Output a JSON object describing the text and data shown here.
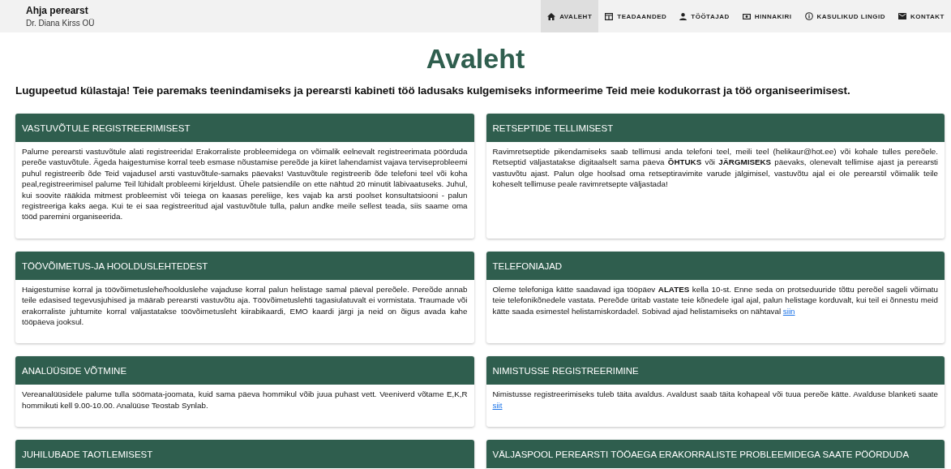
{
  "header": {
    "title": "Ahja perearst",
    "subtitle": "Dr. Diana Kirss OÜ"
  },
  "nav": [
    {
      "label": "AVALEHT",
      "kind": "home",
      "selected": true
    },
    {
      "label": "TEADAANDED",
      "kind": "board",
      "selected": false
    },
    {
      "label": "TÖÖTAJAD",
      "kind": "person",
      "selected": false
    },
    {
      "label": "HINNAKIRI",
      "kind": "cash",
      "selected": false
    },
    {
      "label": "KASULIKUD LINGID",
      "kind": "info",
      "selected": false
    },
    {
      "label": "KONTAKT",
      "kind": "mail",
      "selected": false
    }
  ],
  "page_title": "Avaleht",
  "intro": "Lugupeetud külastaja! Teie paremaks teenindamiseks ja perearsti kabineti töö ladusaks kulgemiseks informeerime Teid meie kodukorrast ja töö organiseerimisest.",
  "cards": [
    {
      "title": "VASTUVÕTULE REGISTREERIMISEST",
      "body": [
        {
          "kind": "text",
          "text": "Palume perearsti vastuvõtule alati registreerida! Erakorraliste probleemidega on võimalik eelnevalt registreerimata pöörduda pereõe vastuvõtule. Ägeda haigestumise korral teeb esmase nõustamise pereõde ja kiiret lahendamist vajava terviseprobleemi puhul registreerib õde Teid vajadusel arsti vastuvõtule-samaks päevaks! Vastuvõtule registreerib õde telefoni teel või koha peal,registreerimisel palume Teil lühidalt probleemi kirjeldust. Ühele patsiendile on ette nähtud 20 minutit läbivaatuseks. Juhul, kui soovite rääkida mitmest probleemist või teiega on kaasas pereliige, kes vajab ka arsti poolset konsultatsiooni - palun registreeriga kaks aega. Kui te ei saa registreeritud ajal vastuvõtule tulla, palun andke meile sellest teada, siis saame oma tööd paremini organiseerida."
        }
      ]
    },
    {
      "title": "RETSEPTIDE TELLIMISEST",
      "body": [
        {
          "kind": "text",
          "text": "Ravimretseptide pikendamiseks saab tellimusi anda telefoni teel, meili teel (helikaur@hot.ee) või kohale tulles pereõele. Retseptid väljastatakse digitaalselt sama päeva **ÕHTUKS** või **JÄRGMISEKS** päevaks, olenevalt tellimise ajast ja perearsti vastuvõtu ajast. Palun olge hoolsad oma retseptiravimite varude jälgimisel, vastuvõtu ajal ei ole perearstil võimalik teile koheselt tellimuse peale ravimretsepte väljastada!"
        }
      ]
    },
    {
      "title": "TÖÖVÕIMETUS-JA HOOLDUSLEHTEDEST",
      "body": [
        {
          "kind": "text",
          "text": "Haigestumise korral ja töövõimetuslehe/hoolduslehe vajaduse korral palun helistage samal päeval pereõele. Pereõde annab teile edasised tegevusjuhised ja määrab perearsti vastuvõtu aja. Töövõimetuslehti tagasiulatuvalt ei vormistata. Traumade või erakorraliste juhtumite korral väljastatakse töövõimetusleht kiirabikaardi, EMO kaardi järgi ja neid on õigus avada kahe tööpäeva jooksul."
        }
      ]
    },
    {
      "title": "TELEFONIAJAD",
      "body": [
        {
          "kind": "text",
          "text": "Oleme telefoniga kätte saadavad iga tööpäev **ALATES** kella 10-st. Enne seda on protseduuride tõttu pereõel sageli võimatu teie telefonikõnedele vastata. Pereõde üritab vastate teie kõnedele igal ajal, palun helistage korduvalt, kui teil ei õnnestu meid kätte saada esimestel helistamiskordadel. Sobivad ajad helistamiseks on nähtaval"
        },
        {
          "kind": "link",
          "text": "siin"
        }
      ]
    },
    {
      "title": "ANALÜÜSIDE VÕTMINE",
      "body": [
        {
          "kind": "text",
          "text": "Vereanalüüsidele palume tulla söömata-joomata, kuid sama päeva hommikul võib juua puhast vett. Veeniverd võtame E,K,R hommikuti kell 9.00-10.00. Analüüse Teostab Synlab."
        }
      ]
    },
    {
      "title": "NIMISTUSSE REGISTREERIMINE",
      "body": [
        {
          "kind": "text",
          "text": "Nimistusse registreerimiseks tuleb täita avaldus. Avaldust saab täita kohapeal või tuua pereõe kätte. Avalduse blanketi saate"
        },
        {
          "kind": "link",
          "text": "siit"
        }
      ]
    },
    {
      "title": "JUHILUBADE TAOTLEMISEST"
    },
    {
      "title": "VÄLJASPOOL PEREARSTI TÖÖAEGA ERAKORRALISTE PROBLEEMIDEGA SAATE PÖÖRDUDA"
    }
  ]
}
